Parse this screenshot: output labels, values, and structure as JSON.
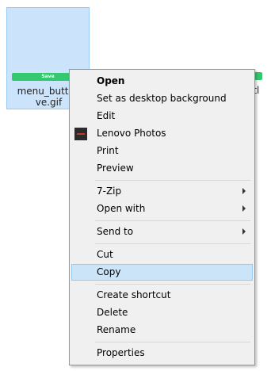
{
  "file": {
    "thumbnail_text": "Save",
    "name_line1": "menu_button",
    "name_line2": "ve.gif",
    "accent_color": "#35c96f"
  },
  "other_file": {
    "label_fragment": "itl"
  },
  "context_menu": {
    "items": [
      {
        "label": "Open",
        "bold": true
      },
      {
        "label": "Set as desktop background"
      },
      {
        "label": "Edit"
      },
      {
        "label": "Lenovo Photos",
        "icon": "lenovo-photos-icon"
      },
      {
        "label": "Print"
      },
      {
        "label": "Preview"
      },
      {
        "label": "7-Zip",
        "submenu": true
      },
      {
        "label": "Open with",
        "submenu": true
      },
      {
        "label": "Send to",
        "submenu": true
      },
      {
        "label": "Cut"
      },
      {
        "label": "Copy",
        "highlighted": true
      },
      {
        "label": "Create shortcut"
      },
      {
        "label": "Delete"
      },
      {
        "label": "Rename"
      },
      {
        "label": "Properties"
      }
    ],
    "highlight_color": "#cce4f7"
  }
}
